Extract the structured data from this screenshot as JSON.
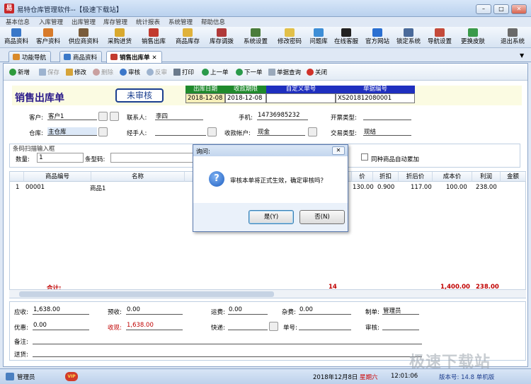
{
  "window": {
    "title": "易特仓库管理软件--【极速下载站】",
    "app_icon": "易"
  },
  "menubar": [
    "基本信息",
    "入库管理",
    "出库管理",
    "库存管理",
    "统计报表",
    "系统管理",
    "帮助信息"
  ],
  "toolbar": [
    "商品资料",
    "客户资料",
    "供应商资料",
    "采购进货",
    "销售出库",
    "商品库存",
    "库存调拨",
    "系统设置",
    "修改密码",
    "问题库",
    "在线客服",
    "官方网站",
    "锁定系统",
    "导航设置",
    "更换皮肤",
    "退出系统"
  ],
  "tabs": [
    "功能导航",
    "商品资料",
    "销售出库单"
  ],
  "doc_toolbar": {
    "new": "新增",
    "save": "保存",
    "edit": "修改",
    "delete": "删除",
    "audit": "审核",
    "unaudit": "反审",
    "print": "打印",
    "prev": "上一单",
    "next": "下一单",
    "query": "单据查询",
    "close": "关闭"
  },
  "doc_header": {
    "title": "销售出库单",
    "status": "未审核",
    "cols": [
      {
        "label": "出库日期",
        "value": "2018-12-08"
      },
      {
        "label": "收款期限",
        "value": "2018-12-08"
      },
      {
        "label": "自定义单号",
        "value": ""
      },
      {
        "label": "单据编号",
        "value": "XS201812080001"
      }
    ]
  },
  "form": {
    "customer_label": "客户:",
    "customer": "客户1",
    "contact_label": "联系人:",
    "contact": "李四",
    "phone_label": "手机:",
    "phone": "14736985232",
    "invoice_label": "开票类型:",
    "invoice": "",
    "warehouse_label": "仓库:",
    "warehouse": "主仓库",
    "handler_label": "经手人:",
    "handler": "",
    "account_label": "收款帐户:",
    "account": "现金",
    "trade_label": "交易类型:",
    "trade": "现结"
  },
  "scan": {
    "legend": "条码扫描输入框",
    "qty_label": "数量:",
    "qty": "1",
    "barcode_label": "条型码:",
    "merge_label": "同种商品自动累加"
  },
  "grid": {
    "headers": [
      "商品编号",
      "名称",
      "单位",
      "价",
      "折扣",
      "折后价",
      "成本价",
      "利润",
      "金额"
    ],
    "rows": [
      {
        "no": "1",
        "code": "00001",
        "name": "商品1",
        "price": "130.00",
        "discount": "0.900",
        "after": "117.00",
        "cost": "100.00",
        "profit": "238.00"
      }
    ],
    "total_label": "合计:",
    "total_qty": "14",
    "total_cost": "1,400.00",
    "total_profit": "238.00"
  },
  "footer": {
    "receivable_label": "应收:",
    "receivable": "1,638.00",
    "prepaid_label": "预收:",
    "prepaid": "0.00",
    "freight_label": "运费:",
    "freight": "0.00",
    "misc_label": "杂费:",
    "misc": "0.00",
    "maker_label": "制单:",
    "maker": "管理员",
    "discount_label": "优惠:",
    "discount": "0.00",
    "received_label": "收现:",
    "received": "1,638.00",
    "express_label": "快递:",
    "express": "",
    "tracking_label": "单号:",
    "tracking": "",
    "auditor_label": "审核:",
    "auditor": "",
    "remark_label": "备注:",
    "delivery_label": "送货:"
  },
  "dialog": {
    "title": "询问:",
    "message": "审核本单将正式生效，确定审核吗？",
    "yes": "是(Y)",
    "no": "否(N)",
    "close": "✕"
  },
  "statusbar": {
    "user": "管理员",
    "vip": "VIP",
    "date": "2018年12月8日",
    "weekday": "星期六",
    "time": "12:01:06",
    "version": "版本号: 14.8 单机版"
  },
  "watermark": "极速下载站"
}
